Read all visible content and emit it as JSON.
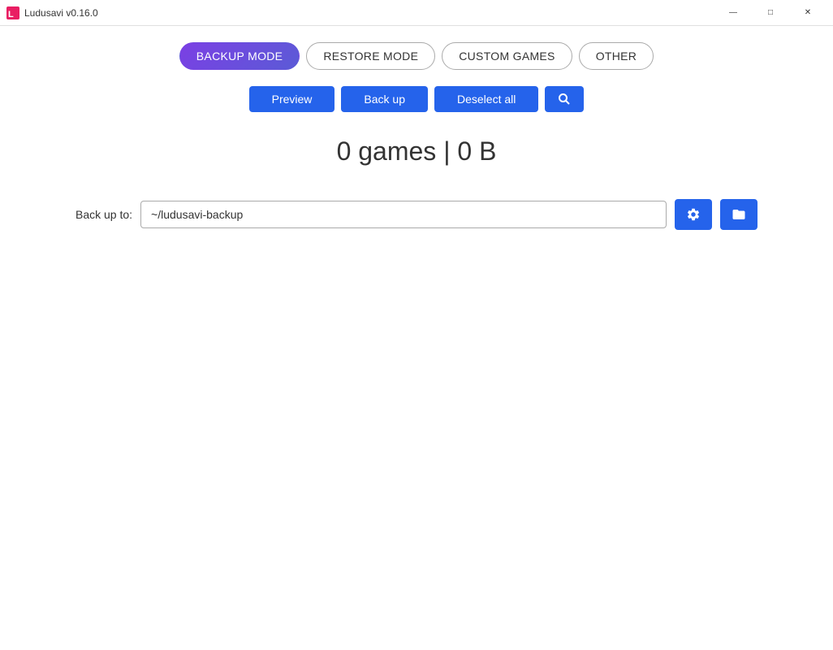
{
  "titlebar": {
    "app_icon": "app-icon",
    "title": "Ludusavi v0.16.0",
    "minimize_label": "minimize",
    "maximize_label": "maximize",
    "close_label": "close"
  },
  "tabs": [
    {
      "id": "backup",
      "label": "BACKUP MODE",
      "active": true
    },
    {
      "id": "restore",
      "label": "RESTORE MODE",
      "active": false
    },
    {
      "id": "custom",
      "label": "CUSTOM GAMES",
      "active": false
    },
    {
      "id": "other",
      "label": "OTHER",
      "active": false
    }
  ],
  "actions": {
    "preview_label": "Preview",
    "backup_label": "Back up",
    "deselect_label": "Deselect all",
    "search_icon": "search-icon"
  },
  "stats": {
    "display": "0 games  |  0 B"
  },
  "backup_destination": {
    "label": "Back up to:",
    "value": "~/ludusavi-backup",
    "placeholder": "~/ludusavi-backup",
    "gear_icon": "gear-icon",
    "folder_icon": "folder-icon"
  }
}
